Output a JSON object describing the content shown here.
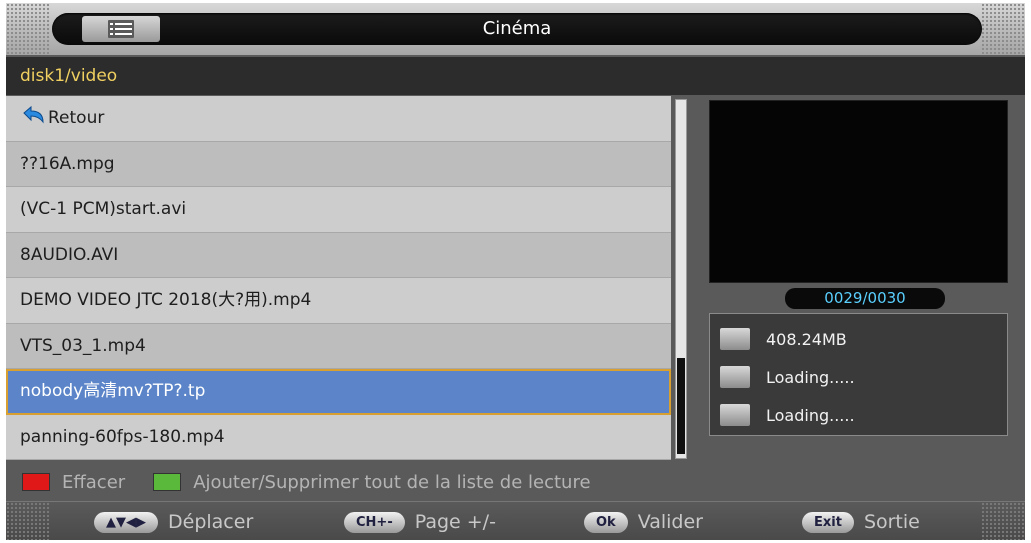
{
  "header": {
    "title": "Cinéma",
    "menu_icon": "list-icon"
  },
  "path": "disk1/video",
  "files": {
    "back_label": "Retour",
    "items": [
      "??16A.mpg",
      "(VC-1 PCM)start.avi",
      "8AUDIO.AVI",
      "DEMO VIDEO JTC 2018(大?用).mp4",
      "VTS_03_1.mp4",
      "nobody高清mv?TP?.tp",
      "panning-60fps-180.mp4"
    ],
    "selected_index": 5
  },
  "preview": {
    "counter": "0029/0030",
    "size": "408.24MB",
    "status1": "Loading.....",
    "status2": "Loading....."
  },
  "colorkeys": {
    "red_label": "Effacer",
    "green_label": "Ajouter/Supprimer tout de la liste de lecture",
    "red_color": "#e01818",
    "green_color": "#5ab83a"
  },
  "footer": {
    "move_key": "▲▼◀▶",
    "move_label": "Déplacer",
    "page_key": "CH+-",
    "page_label": "Page +/-",
    "ok_key": "Ok",
    "ok_label": "Valider",
    "exit_key": "Exit",
    "exit_label": "Sortie"
  }
}
